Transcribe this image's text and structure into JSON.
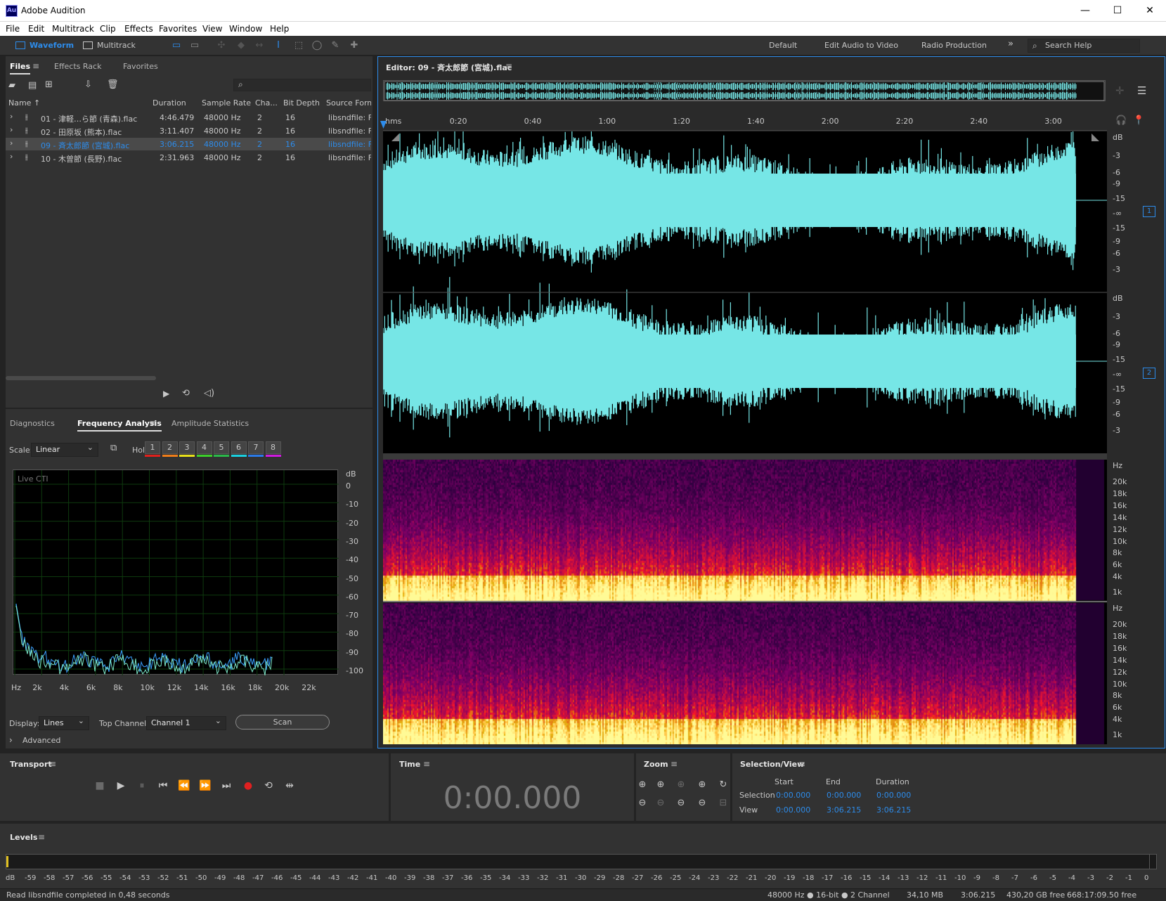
{
  "window": {
    "title": "Adobe Audition",
    "icon_text": "Au",
    "minimize": "—",
    "maximize": "☐",
    "close": "✕"
  },
  "menu": [
    "File",
    "Edit",
    "Multitrack",
    "Clip",
    "Effects",
    "Favorites",
    "View",
    "Window",
    "Help"
  ],
  "toolbar": {
    "waveform_label": "Waveform",
    "multitrack_label": "Multitrack",
    "workspaces": [
      "Default",
      "Edit Audio to Video",
      "Radio Production"
    ],
    "more": "»",
    "search_placeholder": "Search Help"
  },
  "files_panel": {
    "tabs": [
      "Files",
      "Effects Rack",
      "Favorites"
    ],
    "columns": [
      "Name ↑",
      "Duration",
      "Sample Rate",
      "Cha...",
      "Bit Depth",
      "Source Form..."
    ],
    "rows": [
      {
        "name": "01 - 津軽…ら節 (青森).flac",
        "duration": "4:46.479",
        "rate": "48000 Hz",
        "ch": "2",
        "bits": "16",
        "source": "libsndfile: FL"
      },
      {
        "name": "02 - 田原坂 (熊本).flac",
        "duration": "3:11.407",
        "rate": "48000 Hz",
        "ch": "2",
        "bits": "16",
        "source": "libsndfile: FL"
      },
      {
        "name": "09 - 斉太郎節 (宮城).flac",
        "duration": "3:06.215",
        "rate": "48000 Hz",
        "ch": "2",
        "bits": "16",
        "source": "libsndfile: FL",
        "selected": true
      },
      {
        "name": "10 - 木曽節 (長野).flac",
        "duration": "2:31.963",
        "rate": "48000 Hz",
        "ch": "2",
        "bits": "16",
        "source": "libsndfile: FL"
      }
    ]
  },
  "analysis_panel": {
    "tabs": [
      "Diagnostics",
      "Frequency Analysis",
      "Amplitude Statistics"
    ],
    "scale_label": "Scale:",
    "scale_value": "Linear",
    "hold_label": "Hold:",
    "hold": [
      {
        "n": "1",
        "color": "#e0201c"
      },
      {
        "n": "2",
        "color": "#f07d1a"
      },
      {
        "n": "3",
        "color": "#e8e01a"
      },
      {
        "n": "4",
        "color": "#3ccf2a"
      },
      {
        "n": "5",
        "color": "#2ab84a"
      },
      {
        "n": "6",
        "color": "#1ad0e0"
      },
      {
        "n": "7",
        "color": "#2a7ae8"
      },
      {
        "n": "8",
        "color": "#d01ae0"
      }
    ],
    "live_cti": "Live CTI",
    "y_unit": "dB",
    "y_ticks": [
      "0",
      "-10",
      "-20",
      "-30",
      "-40",
      "-50",
      "-60",
      "-70",
      "-80",
      "-90",
      "-100"
    ],
    "x_ticks": [
      "Hz",
      "2k",
      "4k",
      "6k",
      "8k",
      "10k",
      "12k",
      "14k",
      "16k",
      "18k",
      "20k",
      "22k"
    ],
    "display_label": "Display:",
    "display_value": "Lines",
    "top_channel_label": "Top Channel:",
    "top_channel_value": "Channel 1",
    "scan_label": "Scan",
    "advanced_label": "Advanced"
  },
  "editor": {
    "title": "Editor: 09 - 斉太郎節 (宮城).flac",
    "ruler": [
      "hms",
      "0:20",
      "0:40",
      "1:00",
      "1:20",
      "1:40",
      "2:00",
      "2:20",
      "2:40",
      "3:00"
    ],
    "db_unit": "dB",
    "db_ticks": [
      "-3",
      "-6",
      "-9",
      "-15",
      "-∞",
      "-15",
      "-9",
      "-6",
      "-3"
    ],
    "hz_unit": "Hz",
    "hz_ticks": [
      "20k",
      "18k",
      "16k",
      "14k",
      "12k",
      "10k",
      "8k",
      "6k",
      "4k",
      "1k"
    ],
    "channel_badges": [
      "1",
      "2"
    ],
    "waveform_color": "#76e6e6"
  },
  "transport": {
    "title": "Transport"
  },
  "time": {
    "title": "Time",
    "value": "0:00.000"
  },
  "zoom": {
    "title": "Zoom"
  },
  "selection_view": {
    "title": "Selection/View",
    "headers": [
      "Start",
      "End",
      "Duration"
    ],
    "selection_label": "Selection",
    "selection": [
      "0:00.000",
      "0:00.000",
      "0:00.000"
    ],
    "view_label": "View",
    "view": [
      "0:00.000",
      "3:06.215",
      "3:06.215"
    ]
  },
  "levels": {
    "title": "Levels",
    "scale": [
      "dB",
      "-59",
      "-58",
      "-57",
      "-56",
      "-55",
      "-54",
      "-53",
      "-52",
      "-51",
      "-50",
      "-49",
      "-48",
      "-47",
      "-46",
      "-45",
      "-44",
      "-43",
      "-42",
      "-41",
      "-40",
      "-39",
      "-38",
      "-37",
      "-36",
      "-35",
      "-34",
      "-33",
      "-32",
      "-31",
      "-30",
      "-29",
      "-28",
      "-27",
      "-26",
      "-25",
      "-24",
      "-23",
      "-22",
      "-21",
      "-20",
      "-19",
      "-18",
      "-17",
      "-16",
      "-15",
      "-14",
      "-13",
      "-12",
      "-11",
      "-10",
      "-9",
      "-8",
      "-7",
      "-6",
      "-5",
      "-4",
      "-3",
      "-2",
      "-1",
      "0"
    ]
  },
  "status": {
    "message": "Read libsndfile completed in 0,48 seconds",
    "format": "48000 Hz ● 16-bit ● 2 Channel",
    "size": "34,10 MB",
    "duration": "3:06.215",
    "free": "430,20 GB free",
    "free_time": "668:17:09.50 free"
  }
}
